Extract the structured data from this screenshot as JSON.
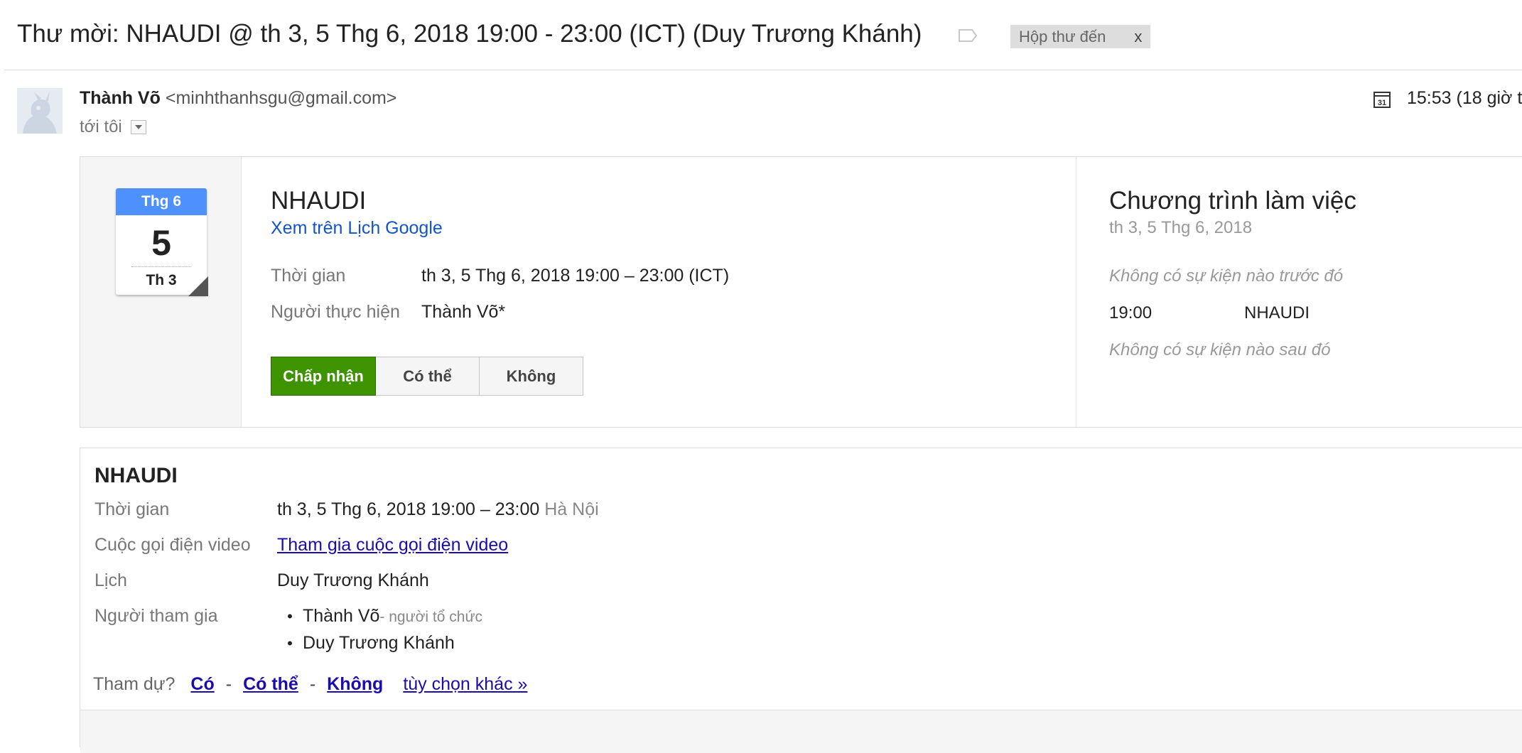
{
  "subject": "Thư mời: NHAUDI @ th 3, 5 Thg 6, 2018 19:00 - 23:00 (ICT) (Duy Trương Khánh)",
  "label_chip": {
    "text": "Hộp thư đến",
    "close": "x"
  },
  "sender": {
    "name": "Thành Võ",
    "email": "<minhthanhsgu@gmail.com>",
    "to": "tới tôi",
    "timestamp": "15:53 (18 giờ t"
  },
  "invite": {
    "date_tile": {
      "month": "Thg 6",
      "day": "5",
      "weekday": "Th 3"
    },
    "title": "NHAUDI",
    "calendar_link": "Xem trên Lịch Google",
    "time_label": "Thời gian",
    "time_value": "th 3, 5 Thg 6, 2018 19:00 – 23:00 (ICT)",
    "organizer_label": "Người thực hiện",
    "organizer_value": "Thành Võ*",
    "buttons": {
      "accept": "Chấp nhận",
      "maybe": "Có thể",
      "decline": "Không"
    },
    "accent_color": "#3d9400"
  },
  "agenda": {
    "title": "Chương trình làm việc",
    "date": "th 3, 5 Thg 6, 2018",
    "before": "Không có sự kiện nào trước đó",
    "event_time": "19:00",
    "event_name": "NHAUDI",
    "after": "Không có sự kiện nào sau đó"
  },
  "details": {
    "title": "NHAUDI",
    "time_label": "Thời gian",
    "time_value": "th 3, 5 Thg 6, 2018 19:00 – 23:00",
    "time_zone": "Hà Nội",
    "video_label": "Cuộc gọi điện video",
    "video_link": "Tham gia cuộc gọi điện video",
    "calendar_label": "Lịch",
    "calendar_value": "Duy Trương Khánh",
    "guests_label": "Người tham gia",
    "guests": [
      {
        "name": "Thành Võ",
        "role": "- người tổ chức"
      },
      {
        "name": "Duy Trương Khánh",
        "role": ""
      }
    ],
    "rsvp": {
      "question": "Tham dự?",
      "yes": "Có",
      "maybe": "Có thể",
      "no": "Không",
      "separator": "-",
      "more": "tùy chọn khác »"
    }
  },
  "icons": {
    "label": "label-tag-icon",
    "avatar": "default-avatar-icon",
    "calendar": "calendar-31-icon",
    "dropdown": "chevron-down-icon"
  },
  "colors": {
    "link": "#1155cc",
    "month_header": "#4d90fe"
  }
}
